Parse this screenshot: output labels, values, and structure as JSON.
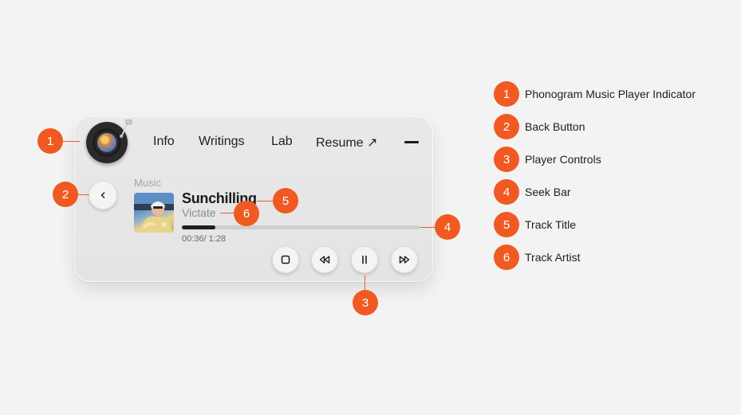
{
  "nav": {
    "items": [
      {
        "label": "Info"
      },
      {
        "label": "Writings"
      },
      {
        "label": "Lab"
      },
      {
        "label": "Resume ↗"
      }
    ]
  },
  "player": {
    "section_label": "Music",
    "track_title": "Sunchilling",
    "track_artist": "Victate",
    "time_display": "00:36/ 1:28",
    "progress_fraction": 0.14
  },
  "annotations": [
    {
      "number": "1",
      "label": "Phonogram Music Player Indicator"
    },
    {
      "number": "2",
      "label": "Back Button"
    },
    {
      "number": "3",
      "label": "Player Controls"
    },
    {
      "number": "4",
      "label": "Seek Bar"
    },
    {
      "number": "5",
      "label": "Track Title"
    },
    {
      "number": "6",
      "label": "Track Artist"
    }
  ],
  "colors": {
    "accent": "#f05a22",
    "background": "#f3f3f3",
    "card": "#e7e7e7"
  }
}
